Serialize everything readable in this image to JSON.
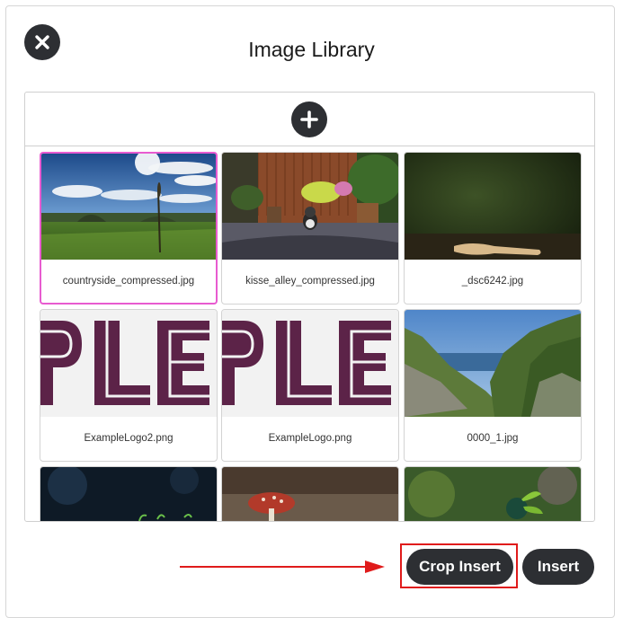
{
  "dialog": {
    "title": "Image Library",
    "close_icon": "close-icon",
    "add_icon": "plus-icon"
  },
  "images": [
    {
      "filename": "countryside_compressed.jpg",
      "selected": true
    },
    {
      "filename": "kisse_alley_compressed.jpg",
      "selected": false
    },
    {
      "filename": "_dsc6242.jpg",
      "selected": false
    },
    {
      "filename": "ExampleLogo2.png",
      "selected": false
    },
    {
      "filename": "ExampleLogo.png",
      "selected": false
    },
    {
      "filename": "0000_1.jpg",
      "selected": false
    },
    {
      "filename": "",
      "selected": false
    },
    {
      "filename": "",
      "selected": false
    },
    {
      "filename": "",
      "selected": false
    }
  ],
  "logo_text": "PLE",
  "footer": {
    "crop_insert_label": "Crop Insert",
    "insert_label": "Insert"
  },
  "colors": {
    "dark_button": "#2d2f33",
    "selection_border": "#e85bd0",
    "annotation_red": "#e01b1b",
    "logo_purple": "#5c2348"
  }
}
